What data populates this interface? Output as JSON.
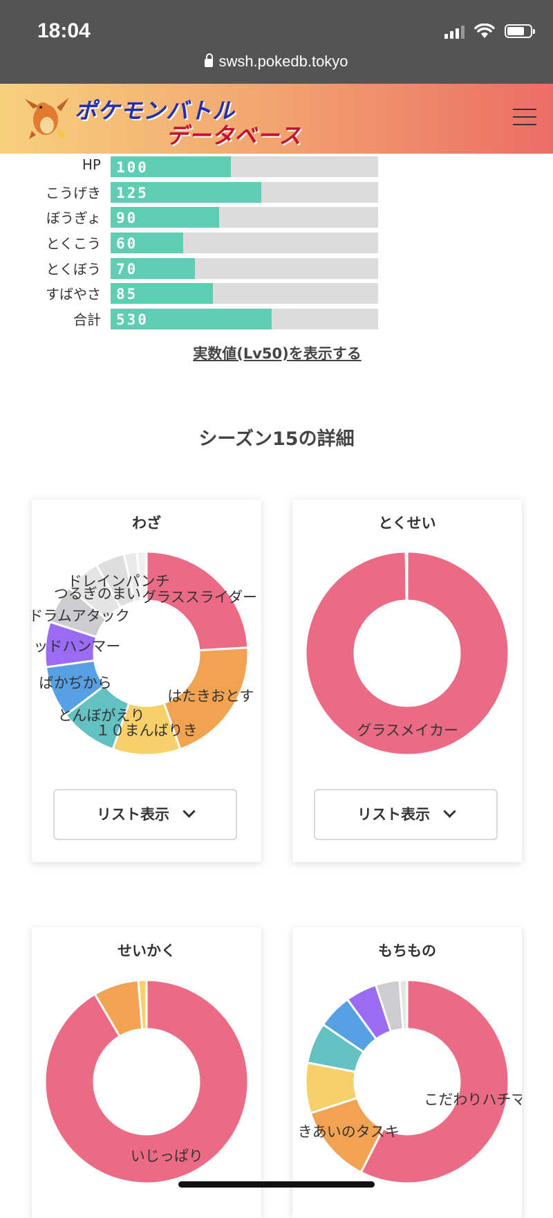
{
  "status_bar": {
    "time": "18:04",
    "url": "swsh.pokedb.tokyo"
  },
  "header": {
    "logo_line1": "ポケモンバトル",
    "logo_line2": "データベース"
  },
  "base_stats": [
    {
      "label": "HP",
      "value": 100
    },
    {
      "label": "こうげき",
      "value": 125
    },
    {
      "label": "ぼうぎょ",
      "value": 90
    },
    {
      "label": "とくこう",
      "value": 60
    },
    {
      "label": "とくぼう",
      "value": 70
    },
    {
      "label": "すばやさ",
      "value": 85
    },
    {
      "label": "合計",
      "value": 530
    }
  ],
  "real_value_link": "実数値(Lv50)を表示する",
  "season_title": "シーズン15の詳細",
  "list_button_label": "リスト表示",
  "colors": {
    "pink": "#ec6b84",
    "orange": "#f1a351",
    "yellow": "#f7d06a",
    "teal": "#64c1c1",
    "blue": "#56a0e4",
    "purple": "#9a6cf4",
    "gray": "#cbcdd0",
    "lightgray": "#e3e4e6",
    "stat_bar": "#5ecdb3"
  },
  "chart_data": [
    {
      "type": "pie",
      "title": "わざ",
      "slices": [
        {
          "label": "グラススライダー",
          "value": 23.5,
          "color": "#ec6b84"
        },
        {
          "label": "はたきおとす",
          "value": 20.0,
          "color": "#f1a351"
        },
        {
          "label": "１０まんばりき",
          "value": 10.5,
          "color": "#f7d06a"
        },
        {
          "label": "とんぼがえり",
          "value": 9.0,
          "color": "#64c1c1"
        },
        {
          "label": "ばかぢから",
          "value": 8.0,
          "color": "#56a0e4"
        },
        {
          "label": "ウッドハンマー",
          "value": 7.0,
          "color": "#9a6cf4"
        },
        {
          "label": "ドラムアタック",
          "value": 6.0,
          "color": "#cbcdd0"
        },
        {
          "label": "つるぎのまい",
          "value": 5.5,
          "color": "#e3e4e6"
        },
        {
          "label": "ドレインパンチ",
          "value": 4.5,
          "color": "#dddee0"
        },
        {
          "label": "",
          "value": 2.0,
          "color": "#e8e9ea"
        },
        {
          "label": "",
          "value": 1.5,
          "color": "#f0f0f0"
        }
      ]
    },
    {
      "type": "pie",
      "title": "とくせい",
      "slices": [
        {
          "label": "グラスメイカー",
          "value": 99.8,
          "color": "#ec6b84"
        },
        {
          "label": "",
          "value": 0.2,
          "color": "#f1a351"
        }
      ]
    },
    {
      "type": "pie",
      "title": "せいかく",
      "slices": [
        {
          "label": "いじっぱり",
          "value": 91.5,
          "color": "#ec6b84"
        },
        {
          "label": "",
          "value": 7.2,
          "color": "#f1a351"
        },
        {
          "label": "",
          "value": 1.3,
          "color": "#f7d06a"
        }
      ]
    },
    {
      "type": "pie",
      "title": "もちもの",
      "slices": [
        {
          "label": "こだわりハチマキ",
          "value": 57.5,
          "color": "#ec6b84"
        },
        {
          "label": "きあいのタスキ",
          "value": 12.5,
          "color": "#f1a351"
        },
        {
          "label": "",
          "value": 8.0,
          "color": "#f7d06a"
        },
        {
          "label": "",
          "value": 6.5,
          "color": "#64c1c1"
        },
        {
          "label": "",
          "value": 5.5,
          "color": "#56a0e4"
        },
        {
          "label": "",
          "value": 5.0,
          "color": "#9a6cf4"
        },
        {
          "label": "",
          "value": 3.8,
          "color": "#cbcdd0"
        },
        {
          "label": "",
          "value": 1.2,
          "color": "#e3e4e6"
        }
      ]
    }
  ]
}
